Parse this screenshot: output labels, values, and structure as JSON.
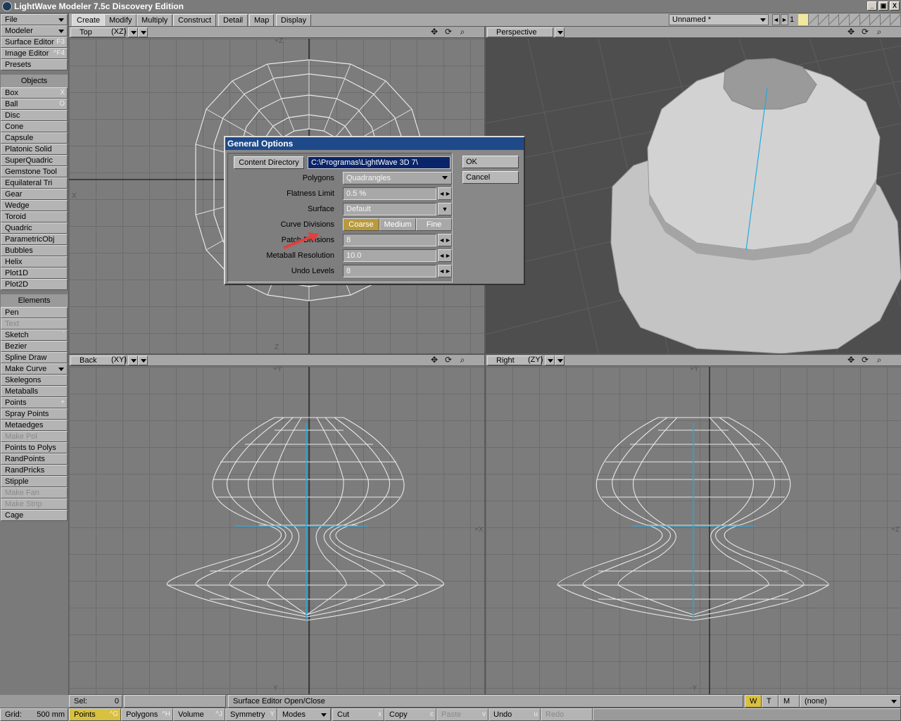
{
  "window": {
    "title": "LightWave Modeler 7.5c Discovery Edition",
    "min": "_",
    "max": "▣",
    "close": "X"
  },
  "tabs": [
    "Create",
    "Modify",
    "Multiply",
    "Construct",
    "Detail",
    "Map",
    "Display"
  ],
  "active_tab": "Create",
  "object_selector": "Unnamed *",
  "layer_number": "1",
  "sidebar": {
    "top": [
      {
        "label": "File",
        "shortcut": "",
        "dropdown": true
      },
      {
        "label": "Modeler",
        "shortcut": "",
        "dropdown": true
      },
      {
        "label": "Surface Editor",
        "shortcut": "F3"
      },
      {
        "label": "Image Editor",
        "shortcut": "^F4"
      },
      {
        "label": "Presets",
        "shortcut": ""
      }
    ],
    "objects_header": "Objects",
    "objects": [
      {
        "label": "Box",
        "shortcut": "X"
      },
      {
        "label": "Ball",
        "shortcut": "O"
      },
      {
        "label": "Disc",
        "shortcut": ""
      },
      {
        "label": "Cone",
        "shortcut": ""
      },
      {
        "label": "Capsule",
        "shortcut": ""
      },
      {
        "label": "Platonic Solid",
        "shortcut": ""
      },
      {
        "label": "SuperQuadric",
        "shortcut": ""
      },
      {
        "label": "Gemstone Tool",
        "shortcut": ""
      },
      {
        "label": "Equilateral Tri",
        "shortcut": ""
      },
      {
        "label": "Gear",
        "shortcut": ""
      },
      {
        "label": "Wedge",
        "shortcut": ""
      },
      {
        "label": "Toroid",
        "shortcut": ""
      },
      {
        "label": "Quadric",
        "shortcut": ""
      },
      {
        "label": "ParametricObj",
        "shortcut": ""
      },
      {
        "label": "Bubbles",
        "shortcut": ""
      },
      {
        "label": "Helix",
        "shortcut": ""
      },
      {
        "label": "Plot1D",
        "shortcut": ""
      },
      {
        "label": "Plot2D",
        "shortcut": ""
      }
    ],
    "elements_header": "Elements",
    "elements": [
      {
        "label": "Pen",
        "shortcut": "",
        "disabled": false
      },
      {
        "label": "Text",
        "shortcut": "",
        "disabled": true
      },
      {
        "label": "Sketch",
        "shortcut": "`",
        "disabled": false
      },
      {
        "label": "Bezier",
        "shortcut": "",
        "disabled": false
      },
      {
        "label": "Spline Draw",
        "shortcut": "",
        "disabled": false
      },
      {
        "label": "Make Curve",
        "shortcut": "",
        "disabled": false,
        "dropdown": true
      },
      {
        "label": "Skelegons",
        "shortcut": "",
        "disabled": false
      },
      {
        "label": "Metaballs",
        "shortcut": "",
        "disabled": false
      },
      {
        "label": "Points",
        "shortcut": "+",
        "disabled": false
      },
      {
        "label": "Spray Points",
        "shortcut": "",
        "disabled": false
      },
      {
        "label": "Metaedges",
        "shortcut": "",
        "disabled": false
      },
      {
        "label": "Make Pol",
        "shortcut": "",
        "disabled": true
      },
      {
        "label": "Points to Polys",
        "shortcut": "",
        "disabled": false
      },
      {
        "label": "RandPoints",
        "shortcut": "",
        "disabled": false
      },
      {
        "label": "RandPricks",
        "shortcut": "",
        "disabled": false
      },
      {
        "label": "Stipple",
        "shortcut": "",
        "disabled": false
      },
      {
        "label": "Make Fan",
        "shortcut": "",
        "disabled": true
      },
      {
        "label": "Make Strip",
        "shortcut": "",
        "disabled": true
      },
      {
        "label": "Cage",
        "shortcut": "",
        "disabled": false
      }
    ]
  },
  "viewports": {
    "top": {
      "name": "Top",
      "axis": "(XZ)",
      "label_pos": "+Z",
      "label_neg": "Z",
      "label_side": "X"
    },
    "perspective": {
      "name": "Perspective"
    },
    "back": {
      "name": "Back",
      "axis": "(XY)",
      "label_pos": "+Y",
      "label_neg": "Y",
      "label_side": "+X"
    },
    "right": {
      "name": "Right",
      "axis": "(ZY)",
      "label_pos": "+Y",
      "label_neg": "-Y",
      "label_side": "+Z"
    }
  },
  "dialog": {
    "title": "General Options",
    "content_directory_button": "Content Directory",
    "content_directory_value": "C:\\Programas\\LightWave 3D 7\\",
    "ok": "OK",
    "cancel": "Cancel",
    "polygons_label": "Polygons",
    "polygons_value": "Quadrangles",
    "flatness_label": "Flatness Limit",
    "flatness_value": "0.5 %",
    "surface_label": "Surface",
    "surface_value": "Default",
    "curve_label": "Curve Divisions",
    "curve_options": [
      "Coarse",
      "Medium",
      "Fine"
    ],
    "curve_selected": "Coarse",
    "patch_label": "Patch Divisions",
    "patch_value": "8",
    "metaball_label": "Metaball Resolution",
    "metaball_value": "10.0",
    "undo_label": "Undo Levels",
    "undo_value": "8"
  },
  "status": {
    "sel_label": "Sel:",
    "sel_value": "0",
    "message": "Surface Editor Open/Close",
    "wtm": [
      "W",
      "T",
      "M"
    ],
    "surface": "(none)"
  },
  "bottom": {
    "grid_label": "Grid:",
    "grid_value": "500 mm",
    "buttons": [
      {
        "label": "Points",
        "shortcut": "^G"
      },
      {
        "label": "Polygons",
        "shortcut": "^H"
      },
      {
        "label": "Volume",
        "shortcut": "^J"
      },
      {
        "label": "Symmetry",
        "shortcut": "Y"
      },
      {
        "label": "Modes",
        "shortcut": ""
      },
      {
        "label": "Cut",
        "shortcut": "x"
      },
      {
        "label": "Copy",
        "shortcut": "c"
      },
      {
        "label": "Paste",
        "shortcut": "v"
      },
      {
        "label": "Undo",
        "shortcut": "u"
      },
      {
        "label": "Redo",
        "shortcut": ""
      }
    ]
  }
}
